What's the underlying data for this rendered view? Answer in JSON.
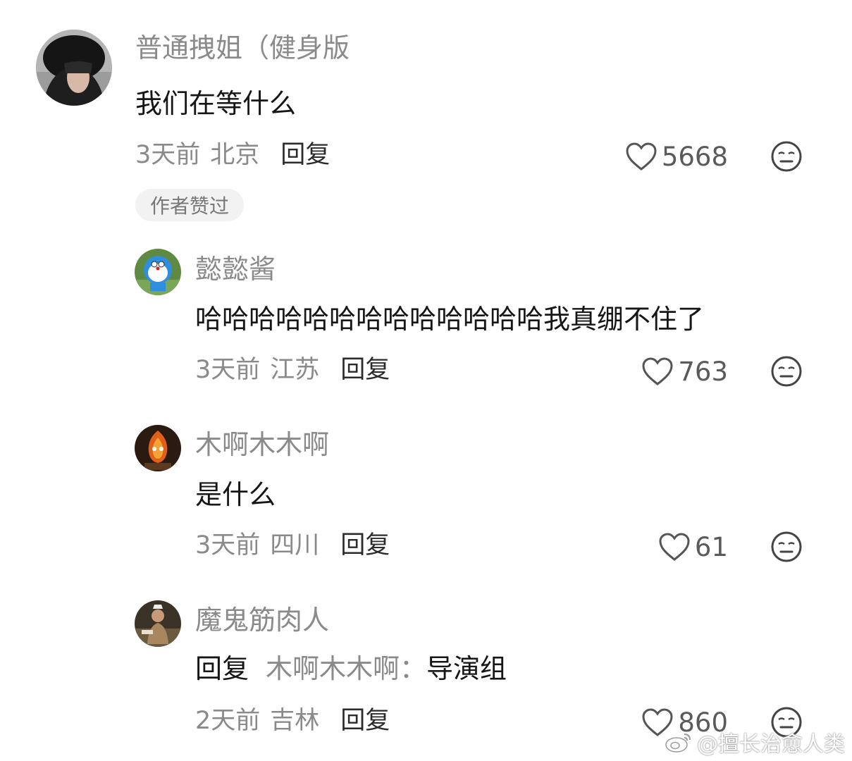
{
  "comments": [
    {
      "username": "普通拽姐（健身版",
      "content": "我们在等什么",
      "time": "3天前",
      "location": "北京",
      "reply_label": "回复",
      "likes": "5668",
      "badge": "作者赞过"
    },
    {
      "username": "懿懿酱",
      "content": "哈哈哈哈哈哈哈哈哈哈哈哈哈我真绷不住了",
      "time": "3天前",
      "location": "江苏",
      "reply_label": "回复",
      "likes": "763"
    },
    {
      "username": "木啊木木啊",
      "content": "是什么",
      "time": "3天前",
      "location": "四川",
      "reply_label": "回复",
      "likes": "61"
    },
    {
      "username": "魔鬼筋肉人",
      "reply_prefix": "回复",
      "reply_to": "木啊木木啊：",
      "content": "导演组",
      "time": "2天前",
      "location": "吉林",
      "reply_label": "回复",
      "likes": "860"
    }
  ],
  "icons": {
    "like": "heart-outline-icon",
    "reaction": "neutral-face-icon"
  },
  "watermark": "@擅长治愈人类",
  "colors": {
    "text_primary": "#161616",
    "text_secondary": "#8a8a8a",
    "badge_bg": "#f2f2f2"
  }
}
